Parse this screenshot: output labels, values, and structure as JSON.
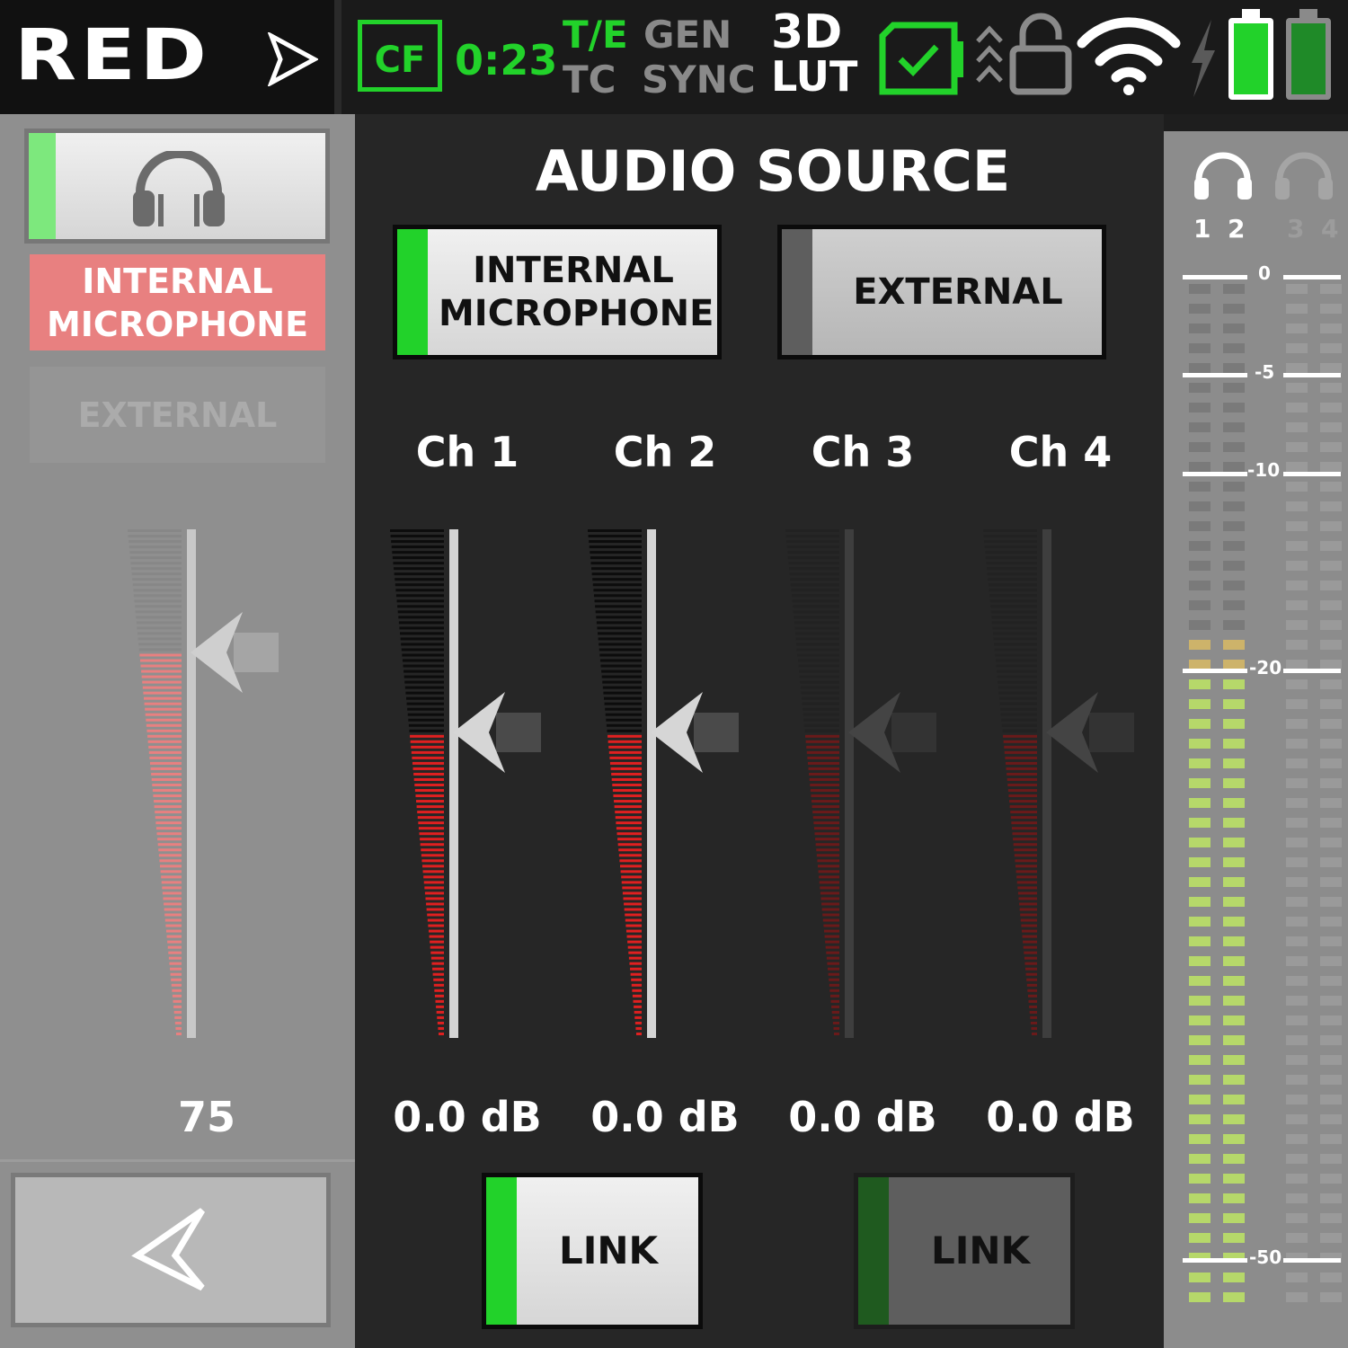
{
  "topbar": {
    "logo": "RED",
    "media": "CF",
    "time": "0:23",
    "te": "T/E",
    "tc": "TC",
    "gen": "GEN",
    "sync": "SYNC",
    "lut_top": "3D",
    "lut_bottom": "LUT"
  },
  "left_panel": {
    "source_selected": "INTERNAL MICROPHONE",
    "source_other": "EXTERNAL",
    "headphone_level": 75,
    "headphone_level_label": "75"
  },
  "main": {
    "title": "AUDIO SOURCE",
    "sources": [
      {
        "label": "INTERNAL MICROPHONE",
        "active": true
      },
      {
        "label": "EXTERNAL",
        "active": false
      }
    ],
    "channels": [
      {
        "label": "Ch 1",
        "gain": "0.0 dB",
        "enabled": true
      },
      {
        "label": "Ch 2",
        "gain": "0.0 dB",
        "enabled": true
      },
      {
        "label": "Ch 3",
        "gain": "0.0 dB",
        "enabled": false
      },
      {
        "label": "Ch 4",
        "gain": "0.0 dB",
        "enabled": false
      }
    ],
    "links": [
      {
        "label": "LINK",
        "active": true
      },
      {
        "label": "LINK",
        "active": false
      }
    ]
  },
  "meter": {
    "channels": [
      "1",
      "2",
      "3",
      "4"
    ],
    "scale": [
      "0",
      "-5",
      "-10",
      "-20",
      "-50"
    ]
  },
  "colors": {
    "accent_green": "#22d22a",
    "meter_red": "#e02020",
    "level_yellow_green": "#b6d86a",
    "selected_red": "#e88080"
  }
}
